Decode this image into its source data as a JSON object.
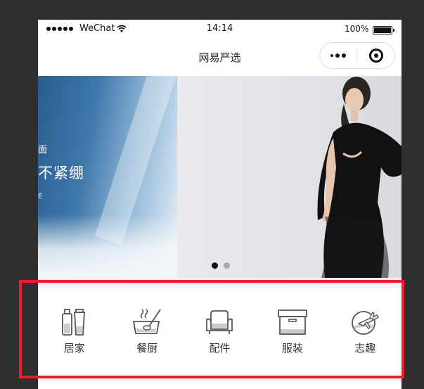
{
  "status_bar": {
    "carrier": "WeChat",
    "time": "14:14",
    "battery": "100%"
  },
  "nav": {
    "title": "网易严选"
  },
  "banner": {
    "left_slide": {
      "line1": "面",
      "line2": "不紧绷",
      "line3": "E"
    },
    "active_index": 0,
    "slide_count": 2
  },
  "categories": [
    {
      "label": "居家",
      "icon": "bottles-icon"
    },
    {
      "label": "餐厨",
      "icon": "cooking-pot-icon"
    },
    {
      "label": "配件",
      "icon": "armchair-icon"
    },
    {
      "label": "服装",
      "icon": "box-icon"
    },
    {
      "label": "志趣",
      "icon": "globe-plane-icon"
    }
  ],
  "colors": {
    "highlight": "#e8202a",
    "background": "#2f2f2f"
  }
}
